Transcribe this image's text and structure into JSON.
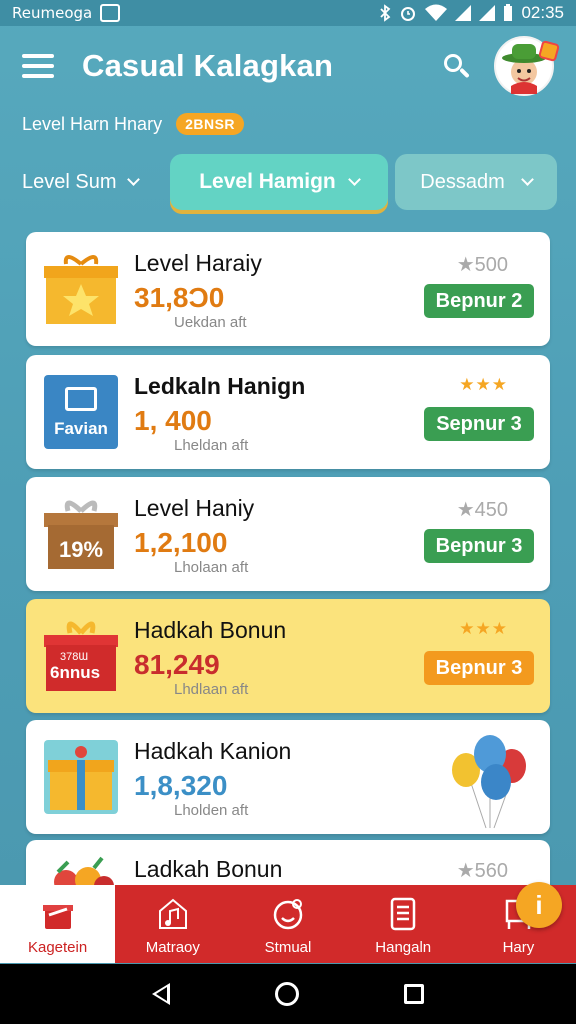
{
  "status_bar": {
    "carrier": "Reumeoga",
    "time": "02:35",
    "icons": [
      "bluetooth-icon",
      "alarm-icon",
      "wifi-icon",
      "signal-icon",
      "battery-icon"
    ]
  },
  "header": {
    "title": "Casual Kalagkan",
    "menu_icon": "hamburger-icon",
    "search_icon": "search-icon",
    "avatar_icon": "user-avatar-icon"
  },
  "subheader": {
    "label": "Level Harn Hnary",
    "badge": "2BNSR"
  },
  "filters": [
    {
      "label": "Level Sum",
      "active": false
    },
    {
      "label": "Level Hamign",
      "active": true
    },
    {
      "label": "Dessadm",
      "active": false
    }
  ],
  "cards": [
    {
      "title": "Level Haraiy",
      "value": "31,8Ɔ0",
      "sub": "Uekdan aft",
      "rating": "500",
      "cta": "Bepnur 2",
      "icon": "gift-box-icon",
      "highlight": false
    },
    {
      "title": "Ledkaln Hanign",
      "value": "1, 400",
      "sub": "Lheldan aft",
      "rating": "★★★",
      "cta": "Sepnur 3",
      "icon": "tablet-icon",
      "thumb_label": "Favian",
      "highlight": false
    },
    {
      "title": "Level Haniy",
      "value": "1,2,100",
      "sub": "Lholaan aft",
      "rating": "450",
      "cta": "Bepnur 3",
      "icon": "gift-box-icon",
      "thumb_label": "19%",
      "highlight": false
    },
    {
      "title": "Hadkah Bonun",
      "value": "81,249",
      "sub": "Lhdlaan aft",
      "rating": "★★★",
      "cta": "Bepnur 3",
      "icon": "gift-box-icon",
      "thumb_label": "6nnus",
      "thumb_sublabel": "378Ɯ",
      "highlight": true
    },
    {
      "title": "Hadkah Kanion",
      "value": "1,8,320",
      "sub": "Lholden aft",
      "rating": "",
      "cta": "",
      "icon": "gift-box-icon",
      "highlight": false,
      "accessory": "balloons-icon"
    },
    {
      "title": "Ladkah Bonun",
      "value": "",
      "sub": "",
      "rating": "560",
      "cta": "",
      "icon": "fruit-basket-icon",
      "highlight": false
    }
  ],
  "bottom_nav": [
    {
      "label": "Kagetein",
      "icon": "gift-icon",
      "active": true
    },
    {
      "label": "Matraoy",
      "icon": "music-note-icon",
      "active": false
    },
    {
      "label": "Stmual",
      "icon": "smiley-icon",
      "active": false
    },
    {
      "label": "Hangaln",
      "icon": "list-icon",
      "active": false
    },
    {
      "label": "Hary",
      "icon": "chair-icon",
      "active": false
    }
  ],
  "fab": {
    "label": "i"
  },
  "colors": {
    "accent": "#63d3c4",
    "brand_red": "#d12a2a",
    "cta_green": "#3a9e52",
    "cta_orange": "#f39a1e",
    "value_orange": "#e07b12",
    "value_blue": "#3b8fc6",
    "highlight": "#fbe37c"
  }
}
